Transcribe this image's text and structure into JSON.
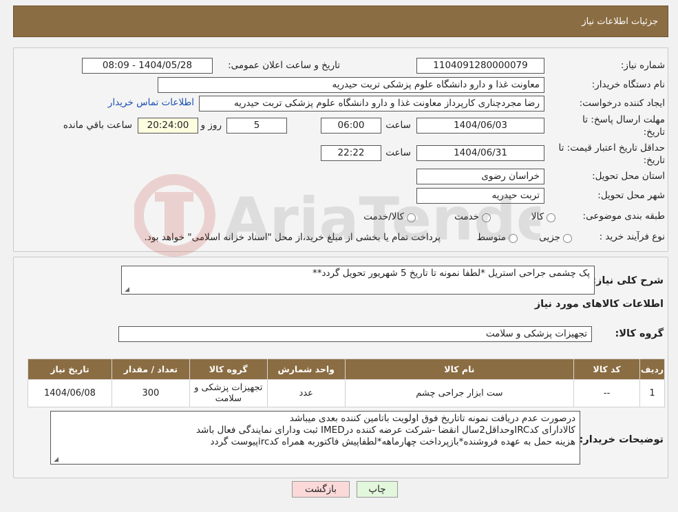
{
  "header": {
    "title": "جزئیات اطلاعات نیاز"
  },
  "form": {
    "need_number_label": "شماره نیاز:",
    "need_number": "1104091280000079",
    "announce_label": "تاریخ و ساعت اعلان عمومی:",
    "announce_value": "1404/05/28 - 08:09",
    "buyer_org_label": "نام دستگاه خریدار:",
    "buyer_org": "معاونت غذا و دارو   دانشگاه علوم پزشکی تربت حیدریه",
    "requester_label": "ایجاد کننده درخواست:",
    "requester": "رضا مجردچناری کارپرداز معاونت غذا و دارو   دانشگاه علوم پزشکی تربت حیدریه",
    "contact_link": "اطلاعات تماس خریدار",
    "deadline_label": "مهلت ارسال پاسخ: تا تاریخ:",
    "deadline_date": "1404/06/03",
    "time_label": "ساعت",
    "deadline_time": "06:00",
    "days_value": "5",
    "days_label": "روز و",
    "remaining_time": "20:24:00",
    "remaining_label": "ساعت باقي مانده",
    "validity_label": "حداقل تاريخ اعتبار قيمت: تا تاریخ:",
    "validity_date": "1404/06/31",
    "validity_time": "22:22",
    "province_label": "استان محل تحویل:",
    "province": "خراسان رضوی",
    "city_label": "شهر محل تحویل:",
    "city": "تربت حیدریه",
    "category_label": "طبقه بندی موضوعی:",
    "category_options": [
      "کالا",
      "خدمت",
      "کالا/خدمت"
    ],
    "process_label": "نوع فرآیند خرید :",
    "process_options": [
      "جزیی",
      "متوسط"
    ],
    "process_note": "پرداخت تمام یا بخشی از مبلغ خرید،از محل \"اسناد خزانه اسلامی\" خواهد بود."
  },
  "details": {
    "description_label": "شرح کلی نیاز:",
    "description": "پک چشمی جراحی استریل  *لطفا نمونه تا تاریخ 5 شهریور تحویل گردد**",
    "goods_info_title": "اطلاعات کالاهای مورد نیاز",
    "goods_group_label": "گروه کالا:",
    "goods_group": "تجهیزات پزشکی و سلامت",
    "table": {
      "headers": [
        "ردیف",
        "کد کالا",
        "نام کالا",
        "واحد شمارش",
        "گروه کالا",
        "تعداد / مقدار",
        "تاریخ نیاز"
      ],
      "rows": [
        [
          "1",
          "--",
          "ست ابزار جراحی چشم",
          "عدد",
          "تجهیزات پزشکی و سلامت",
          "300",
          "1404/06/08"
        ]
      ]
    },
    "buyer_notes_label": "توضیحات خریدار:",
    "buyer_notes": [
      "درصورت عدم دریافت نمونه تاتاریخ فوق اولویت باتامین کننده بعدی میباشد",
      "کالادارای کدIRCوحداقل2سال انقضا -شرکت عرضه کننده درIMED ثبت ودارای نمایندگی فعال باشد",
      "هزینه حمل به عهده فروشنده*بازپرداخت چهارماهه*لطفاپیش فاکتوربه همراه کدircپیوست گردد"
    ]
  },
  "buttons": {
    "print": "چاپ",
    "back": "بازگشت"
  },
  "colors": {
    "header_bg": "#8b6d43",
    "link": "#1a4fb5",
    "back_bg": "#fbd9d9",
    "print_bg": "#e2f7dc"
  }
}
